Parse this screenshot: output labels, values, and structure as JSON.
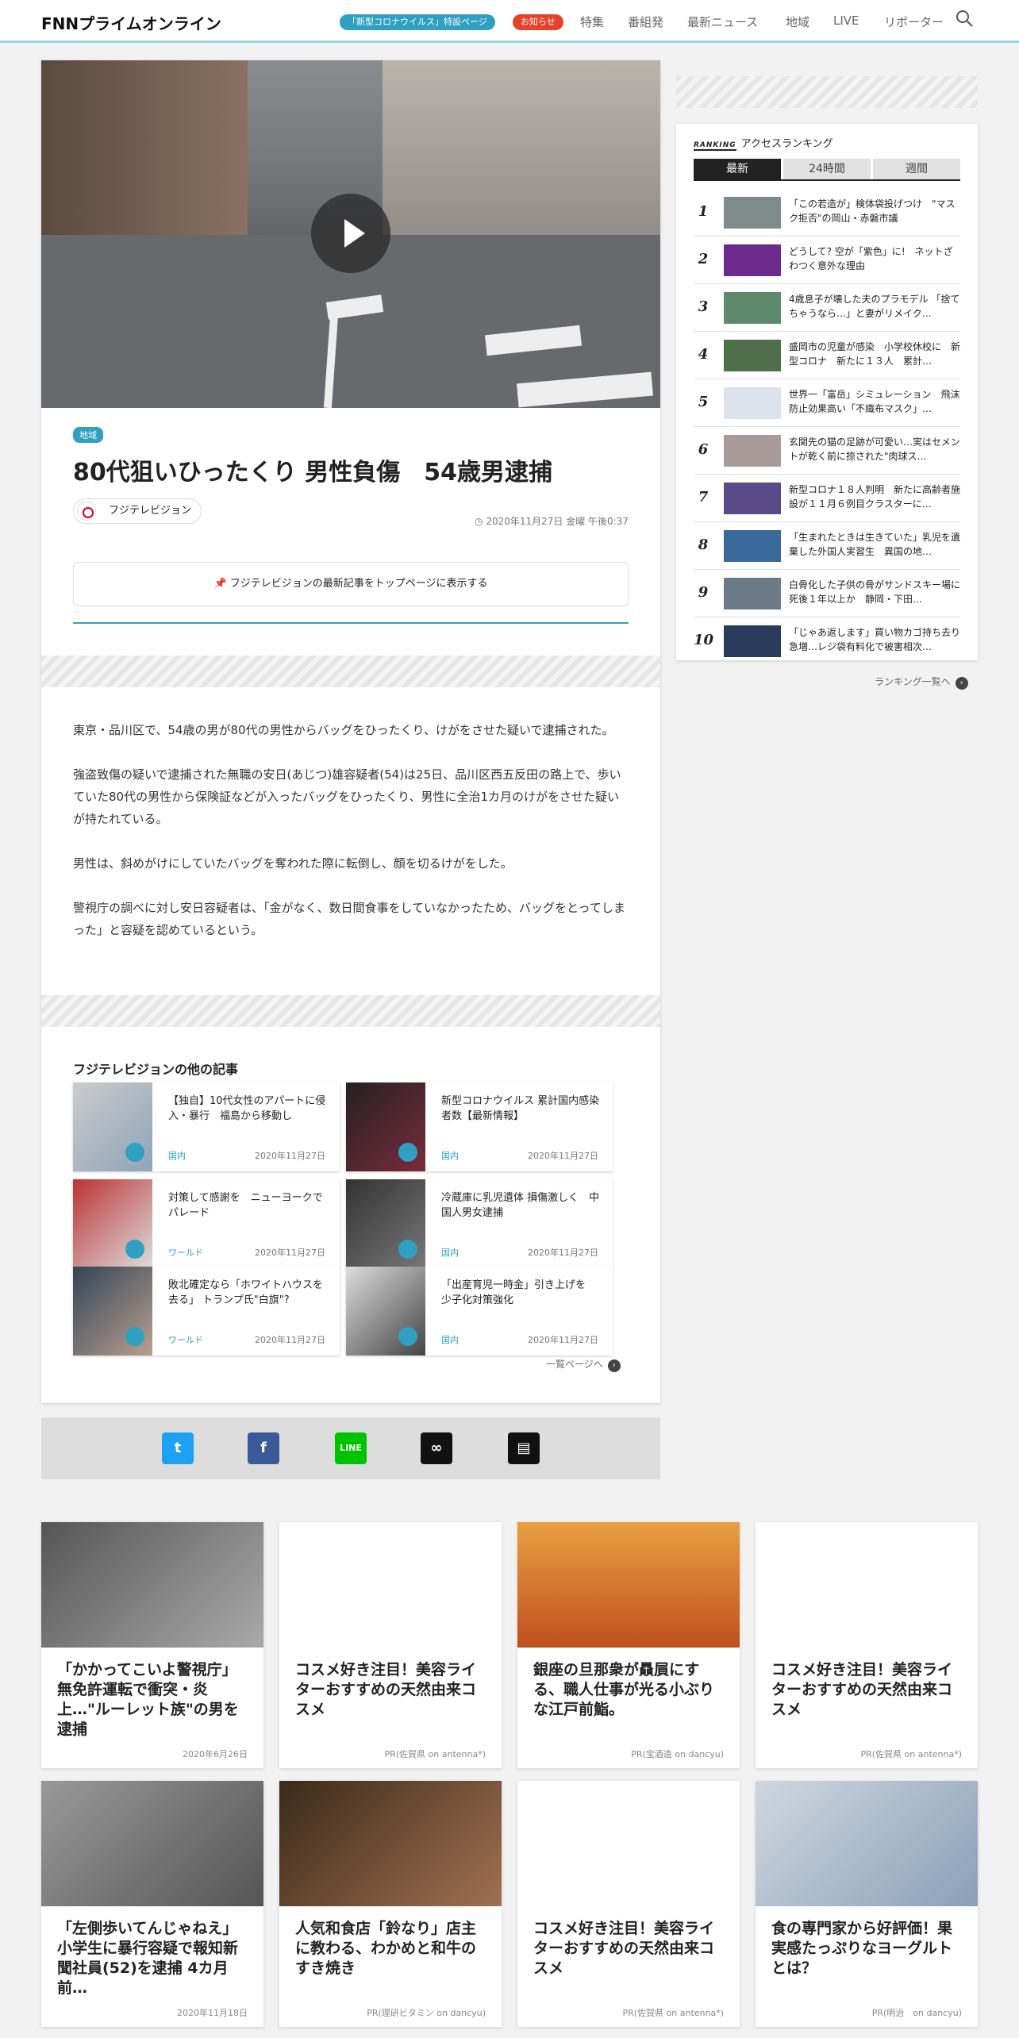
{
  "header": {
    "logo": "FNNプライムオンライン",
    "covid_pill": "「新型コロナウイルス」特設ページ",
    "notice_pill": "お知らせ",
    "nav": [
      "特集",
      "番組発",
      "最新ニュース",
      "地域",
      "LIVE",
      "リポーター"
    ],
    "accent": "#2fa0c2"
  },
  "article": {
    "tag": "地域",
    "title": "80代狙いひったくり 男性負傷　54歳男逮捕",
    "source": "フジテレビジョン",
    "date": "2020年11月27日 金曜 午後0:37",
    "pin_label": "フジテレビジョンの最新記事をトップページに表示する",
    "body": [
      "東京・品川区で、54歳の男が80代の男性からバッグをひったくり、けがをさせた疑いで逮捕された。",
      "強盗致傷の疑いで逮捕された無職の安日(あじつ)雄容疑者(54)は25日、品川区西五反田の路上で、歩いていた80代の男性から保険証などが入ったバッグをひったくり、男性に全治1カ月のけがをさせた疑いが持たれている。",
      "男性は、斜めがけにしていたバッグを奪われた際に転倒し、顔を切るけがをした。",
      "警視庁の調べに対し安日容疑者は、「金がなく、数日間食事をしていなかったため、バッグをとってしまった」と容疑を認めているという。"
    ]
  },
  "other": {
    "heading": "フジテレビジョンの他の記事",
    "more": "一覧ページへ",
    "items": [
      {
        "title": "【独自】10代女性のアパートに侵入・暴行　福島から移動し",
        "cat": "国内",
        "date": "2020年11月27日"
      },
      {
        "title": "新型コロナウイルス 累計国内感染者数【最新情報】",
        "cat": "国内",
        "date": "2020年11月27日"
      },
      {
        "title": "対策して感謝を　ニューヨークでパレード",
        "cat": "ワールド",
        "date": "2020年11月27日"
      },
      {
        "title": "冷蔵庫に乳児遺体 損傷激しく　中国人男女逮捕",
        "cat": "国内",
        "date": "2020年11月27日"
      },
      {
        "title": "敗北確定なら「ホワイトハウスを去る」 トランプ氏\"白旗\"?",
        "cat": "ワールド",
        "date": "2020年11月27日"
      },
      {
        "title": "「出産育児一時金」引き上げを　少子化対策強化",
        "cat": "国内",
        "date": "2020年11月27日"
      }
    ]
  },
  "share": {
    "icons": [
      "twitter-icon",
      "facebook-icon",
      "line-icon",
      "link-icon",
      "comment-icon"
    ]
  },
  "ranking": {
    "label": "RANKING",
    "title": "アクセスランキング",
    "tabs": [
      "最新",
      "24時間",
      "週間"
    ],
    "more": "ランキング一覧へ",
    "items": [
      {
        "n": "1",
        "title": "「この若造が」検体袋投げつけ　\"マスク拒否\"の岡山・赤磐市議"
      },
      {
        "n": "2",
        "title": "どうして? 空が「紫色」に!　ネットざわつく意外な理由"
      },
      {
        "n": "3",
        "title": "4歳息子が壊した夫のプラモデル 「捨てちゃうなら…」と妻がリメイク…"
      },
      {
        "n": "4",
        "title": "盛岡市の児童が感染　小学校休校に　新型コロナ　新たに１３人　累計…"
      },
      {
        "n": "5",
        "title": "世界一「富岳」シミュレーション　飛沫防止効果高い「不織布マスク」…"
      },
      {
        "n": "6",
        "title": "玄関先の猫の足跡が可愛い…実はセメントが乾く前に捺された\"肉球ス…"
      },
      {
        "n": "7",
        "title": "新型コロナ１８人判明　新たに高齢者施設が１１月６例目クラスターに…"
      },
      {
        "n": "8",
        "title": "「生まれたときは生きていた」乳児を遺棄した外国人実習生　異国の地…"
      },
      {
        "n": "9",
        "title": "白骨化した子供の骨がサンドスキー場に　死後１年以上か　静岡・下田…"
      },
      {
        "n": "10",
        "title": "「じゃあ返します」買い物カゴ持ち去り急増…レジ袋有料化で被害相次…"
      }
    ]
  },
  "grid": [
    {
      "title": "「かかってこいよ警視庁」無免許運転で衝突・炎上…\"ルーレット族\"の男を逮捕",
      "foot": "2020年6月26日"
    },
    {
      "title": "コスメ好き注目！美容ライターおすすめの天然由来コスメ",
      "foot": "PR(佐賀県 on antenna*)"
    },
    {
      "title": "銀座の旦那衆が贔屓にする、職人仕事が光る小ぶりな江戸前鮨。",
      "foot": "PR(宝酒造 on dancyu)"
    },
    {
      "title": "コスメ好き注目！美容ライターおすすめの天然由来コスメ",
      "foot": "PR(佐賀県 on antenna*)"
    },
    {
      "title": "「左側歩いてんじゃねえ」小学生に暴行容疑で報知新聞社員(52)を逮捕 4カ月前…",
      "foot": "2020年11月18日"
    },
    {
      "title": "人気和食店「鈴なり」店主に教わる、わかめと和牛のすき焼き",
      "foot": "PR(理研ビタミン on dancyu)"
    },
    {
      "title": "コスメ好き注目！美容ライターおすすめの天然由来コスメ",
      "foot": "PR(佐賀県 on antenna*)"
    },
    {
      "title": "食の専門家から好評価！果実感たっぷりなヨーグルトとは？",
      "foot": "PR(明治　on dancyu)"
    }
  ]
}
